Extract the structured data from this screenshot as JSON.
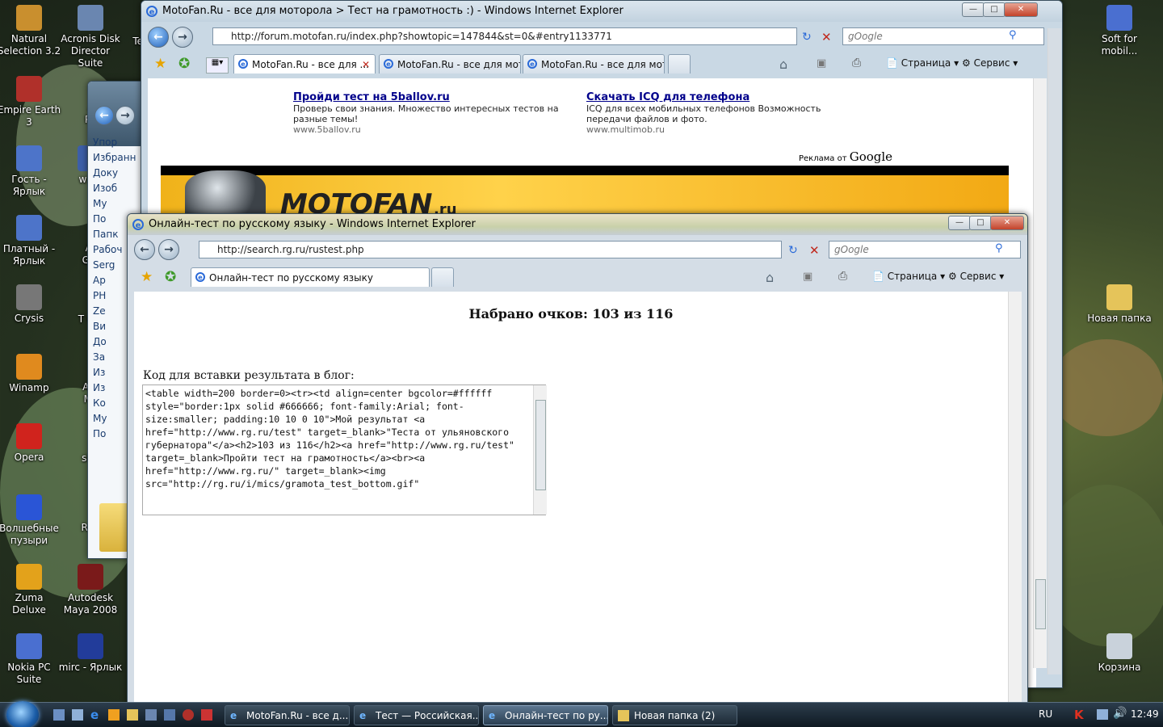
{
  "desktop": {
    "icons_left": [
      {
        "label": "Natural Selection 3.2",
        "color": "#c98f2e"
      },
      {
        "label": "Acronis Disk Director Suite",
        "color": "#6a86b0"
      },
      {
        "label": "Empire Earth 3",
        "color": "#b0302a"
      },
      {
        "label": "Гость - Ярлык",
        "color": "#4d74c9"
      },
      {
        "label": "w3l -",
        "color": "#3d5fa8"
      },
      {
        "label": "Платный - Ярлык",
        "color": "#4d74c9"
      },
      {
        "label": "Crysis",
        "color": "#777"
      },
      {
        "label": "Winamp",
        "color": "#e08a1e"
      },
      {
        "label": "Opera",
        "color": "#d0231d"
      },
      {
        "label": "Волшебные пузыри",
        "color": "#2a55d6"
      },
      {
        "label": "Zuma Deluxe",
        "color": "#e3a21b"
      },
      {
        "label": "Autodesk Maya 2008",
        "color": "#7a1a1a"
      },
      {
        "label": "Nokia PC Suite",
        "color": "#4a6fd0"
      },
      {
        "label": "mirc - Ярлык",
        "color": "#223c9a"
      }
    ],
    "icons_right": [
      {
        "label": "Soft for mobil...",
        "color": "#4a6fd0"
      },
      {
        "label": "Новая папка",
        "color": "#e5c45a"
      },
      {
        "label": "Корзина",
        "color": "#c9d2db"
      }
    ],
    "partial_labels": [
      "Teal",
      "Ac Pho",
      "Ass Gree",
      "T Com",
      "Auto Max",
      "sisco",
      "ReaC 5."
    ]
  },
  "explorer_partial": {
    "items": [
      "Упор",
      "Избранн",
      "Доку",
      "Изоб",
      "Му",
      "По",
      "Папк",
      "Рабоч",
      "Serg",
      "Ар",
      "PH",
      "Ze",
      "Ви",
      "До",
      "За",
      "Из",
      "Из",
      "Ко",
      "Му",
      "По"
    ]
  },
  "back_window": {
    "title": "MotoFan.Ru - все для моторола > Тест на грамотность :) - Windows Internet Explorer",
    "url": "http://forum.motofan.ru/index.php?showtopic=147844&st=0&#entry1133771",
    "search_placeholder": "gOogle",
    "tabs": [
      "MotoFan.Ru - все для ...",
      "MotoFan.Ru - все для мот...",
      "MotoFan.Ru - все для мот..."
    ],
    "toolbar": {
      "page": "Страница",
      "service": "Сервис"
    },
    "ads": [
      {
        "title": "Пройди тест на 5ballov.ru",
        "desc": "Проверь свои знания. Множество интересных тестов на разные темы!",
        "url": "www.5ballov.ru"
      },
      {
        "title": "Скачать ICQ для телефона",
        "desc": "ICQ для всех мобильных телефонов Возможность передачи файлов и фото.",
        "url": "www.multimob.ru"
      }
    ],
    "ads_by_prefix": "Реклама от",
    "ads_by_brand": "Google",
    "banner_text": "MOTOFAN",
    "banner_suffix": ".ru"
  },
  "front_window": {
    "title": "Онлайн-тест по русскому языку - Windows Internet Explorer",
    "url": "http://search.rg.ru/rustest.php",
    "search_placeholder": "gOogle",
    "tab": "Онлайн-тест по русскому языку",
    "toolbar": {
      "page": "Страница",
      "service": "Сервис"
    },
    "score_heading": "Набрано очков: 103 из 116",
    "embed_label": "Код для вставки результата в блог:",
    "embed_code": "<table width=200 border=0><tr><td align=center bgcolor=#ffffff style=\"border:1px solid #666666; font-family:Arial; font-size:smaller; padding:10 10 0 10\">Мой результат <a href=\"http://www.rg.ru/test\" target=_blank>\"Теста от ульяновского губернатора\"</a><h2>103 из 116</h2><a href=\"http://www.rg.ru/test\" target=_blank>Пройти тест на грамотность</a><br><a href=\"http://www.rg.ru/\" target=_blank><img src=\"http://rg.ru/i/mics/gramota_test_bottom.gif\""
  },
  "taskbar": {
    "items": [
      {
        "label": "MotoFan.Ru - все д...",
        "active": false
      },
      {
        "label": "Тест — Российская...",
        "active": false
      },
      {
        "label": "Онлайн-тест по ру...",
        "active": true
      },
      {
        "label": "Новая папка (2)",
        "active": false
      }
    ],
    "lang": "RU",
    "clock": "12:49"
  }
}
